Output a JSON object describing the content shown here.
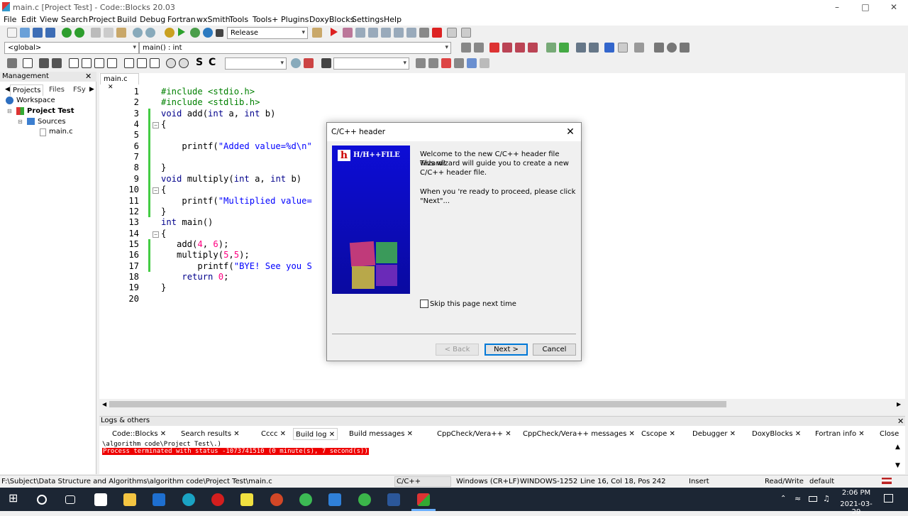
{
  "window": {
    "title": "main.c [Project Test] - Code::Blocks 20.03"
  },
  "menu": [
    "File",
    "Edit",
    "View",
    "Search",
    "Project",
    "Build",
    "Debug",
    "Fortran",
    "wxSmith",
    "Tools",
    "Tools+",
    "Plugins",
    "DoxyBlocks",
    "Settings",
    "Help"
  ],
  "toolbar": {
    "build_target": "Release",
    "scope": "<global>",
    "function": "main() : int",
    "sc_S": "S",
    "sc_C": "C"
  },
  "management": {
    "title": "Management",
    "tabs": [
      "Projects",
      "Files",
      "FSy"
    ],
    "tree": {
      "workspace": "Workspace",
      "project": "Project Test",
      "folder": "Sources",
      "file": "main.c"
    }
  },
  "editor": {
    "tab_label": "main.c",
    "lines": [
      {
        "n": "1",
        "html": "<span class='pp'>#include &lt;stdio.h&gt;</span>"
      },
      {
        "n": "2",
        "html": "<span class='pp'>#include &lt;stdlib.h&gt;</span>"
      },
      {
        "n": "3",
        "html": "<span class='kw'>void</span> add(<span class='kw'>int</span> a, <span class='kw'>int</span> b)"
      },
      {
        "n": "4",
        "html": "{"
      },
      {
        "n": "5",
        "html": ""
      },
      {
        "n": "6",
        "html": "    printf(<span class='str'>\"Added value=%d\\n\"</span>"
      },
      {
        "n": "7",
        "html": ""
      },
      {
        "n": "8",
        "html": "}"
      },
      {
        "n": "9",
        "html": "<span class='kw'>void</span> multiply(<span class='kw'>int</span> a, <span class='kw'>int</span> b)"
      },
      {
        "n": "10",
        "html": "{"
      },
      {
        "n": "11",
        "html": "    printf(<span class='str'>\"Multiplied value=</span>"
      },
      {
        "n": "12",
        "html": "}"
      },
      {
        "n": "13",
        "html": "<span class='kw'>int</span> main()"
      },
      {
        "n": "14",
        "html": "{"
      },
      {
        "n": "15",
        "html": "   add(<span class='num'>4</span>, <span class='num'>6</span>);"
      },
      {
        "n": "16",
        "html": "   multiply(<span class='num'>5</span>,<span class='num'>5</span>);"
      },
      {
        "n": "17",
        "html": "       printf(<span class='str'>\"BYE! See you S</span>"
      },
      {
        "n": "18",
        "html": "    <span class='kw'>return</span> <span class='num'>0</span>;"
      },
      {
        "n": "19",
        "html": "}"
      },
      {
        "n": "20",
        "html": ""
      }
    ]
  },
  "logs": {
    "title": "Logs & others",
    "tabs": [
      "Code::Blocks",
      "Search results",
      "Cccc",
      "Build log",
      "Build messages",
      "CppCheck/Vera++",
      "CppCheck/Vera++ messages",
      "Cscope",
      "Debugger",
      "DoxyBlocks",
      "Fortran info",
      "Close"
    ],
    "line1": "\\algorithm code\\Project Test\\.)",
    "line2": "Process terminated with status -1073741510 (0 minute(s), 7 second(s))"
  },
  "dialog": {
    "title": "C/C++ header",
    "banner": "H/H++FILE",
    "text1": "Welcome to the new C/C++ header file wizard!",
    "text2": "This wizard will guide you to create a new",
    "text3": "C/C++ header file.",
    "text4": "When you 're ready to proceed, please click",
    "text5": "\"Next\"...",
    "skip_label": "Skip this page next time",
    "back": "< Back",
    "next": "Next >",
    "cancel": "Cancel"
  },
  "status": {
    "path": "F:\\Subject\\Data Structure and Algorithms\\algorithm code\\Project Test\\main.c",
    "lang": "C/C++",
    "eol": "Windows (CR+LF)",
    "encoding": "WINDOWS-1252",
    "position": "Line 16, Col 18, Pos 242",
    "mode": "Insert",
    "access": "Read/Write",
    "profile": "default"
  },
  "taskbar": {
    "time": "2:06 PM",
    "date": "2021-03-29"
  }
}
